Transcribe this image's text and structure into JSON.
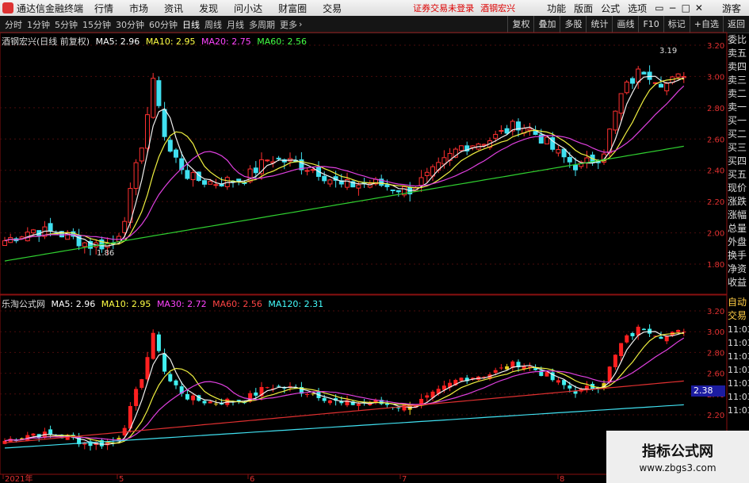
{
  "app": {
    "title": "通达信金融终端",
    "menu": [
      "行情",
      "市场",
      "资讯",
      "发现",
      "问小达",
      "财富圈",
      "交易"
    ],
    "warning": "证券交易未登录",
    "stock_name": "酒钢宏兴",
    "right_menu": [
      "功能",
      "版面",
      "公式",
      "选项",
      "游客"
    ]
  },
  "toolbar": {
    "periods": [
      "分时",
      "1分钟",
      "5分钟",
      "15分钟",
      "30分钟",
      "60分钟",
      "日线",
      "周线",
      "月线",
      "多周期",
      "更多"
    ],
    "active": "日线",
    "right": [
      "复权",
      "叠加",
      "多股",
      "统计",
      "画线",
      "F10",
      "标记",
      "+自选",
      "返回"
    ]
  },
  "main_panel": {
    "name": "酒钢宏兴(日线 前复权)",
    "ma": [
      {
        "label": "MA5: 2.96",
        "color": "#ffffff"
      },
      {
        "label": "MA10: 2.95",
        "color": "#ffff40"
      },
      {
        "label": "MA20: 2.75",
        "color": "#ff40ff"
      },
      {
        "label": "MA60: 2.56",
        "color": "#40ff40"
      }
    ],
    "y_ticks": [
      "3.20",
      "3.00",
      "2.80",
      "2.60",
      "2.40",
      "2.20",
      "2.00",
      "1.80"
    ],
    "high_label": "3.19",
    "low_label": "1.86"
  },
  "sub_panel": {
    "name": "乐淘公式网",
    "ma": [
      {
        "label": "MA5: 2.96",
        "color": "#ffffff"
      },
      {
        "label": "MA10: 2.95",
        "color": "#ffff40"
      },
      {
        "label": "MA30: 2.72",
        "color": "#ff40ff"
      },
      {
        "label": "MA60: 2.56",
        "color": "#ff4040"
      },
      {
        "label": "MA120: 2.31",
        "color": "#40ffff"
      }
    ],
    "y_ticks": [
      "3.20",
      "3.00",
      "2.80",
      "2.60",
      "2.40",
      "2.20"
    ],
    "current": "2.38"
  },
  "side_panel": {
    "items": [
      "委比",
      "卖五",
      "卖四",
      "卖三",
      "卖二",
      "卖一",
      "买一",
      "买二",
      "买三",
      "买四",
      "买五",
      "现价",
      "涨跌",
      "涨幅",
      "总量",
      "外盘",
      "换手",
      "净资",
      "收益"
    ],
    "lower": [
      "自动",
      "交易",
      "11:03",
      "11:03",
      "11:03",
      "11:03",
      "11:03",
      "11:03",
      "11:03",
      "11:04",
      "11:04"
    ]
  },
  "x_axis": [
    "2021年",
    "5",
    "6",
    "7",
    "8"
  ],
  "watermark": {
    "title": "指标公式网",
    "url": "www.zbgs3.com"
  }
}
